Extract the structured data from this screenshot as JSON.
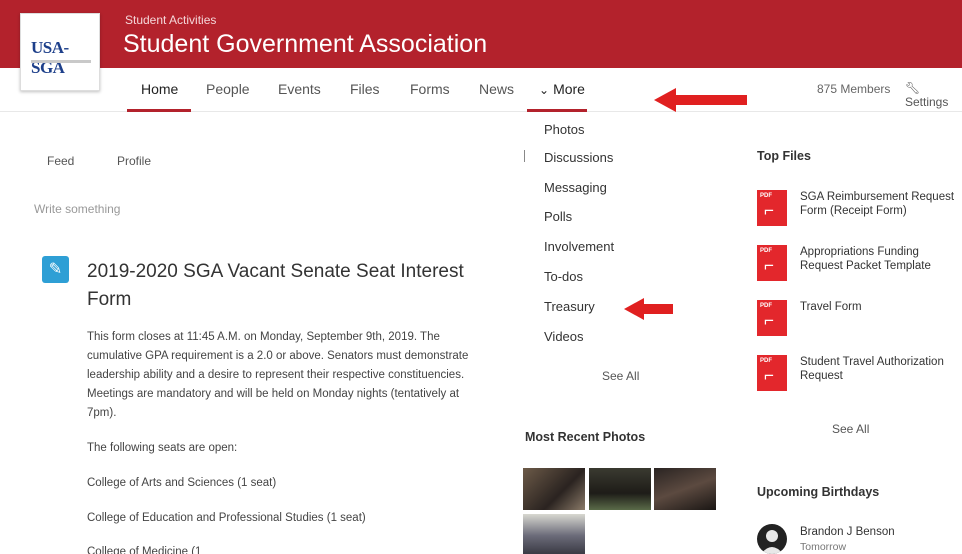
{
  "header": {
    "logo_text": "USA-SGA",
    "category": "Student Activities",
    "title": "Student Government Association"
  },
  "nav": {
    "items": [
      "Home",
      "People",
      "Events",
      "Files",
      "Forms",
      "News"
    ],
    "more_label": "More",
    "members": "875 Members",
    "settings": "Settings"
  },
  "feed": {
    "tabs": [
      "Feed",
      "Profile"
    ],
    "composer_placeholder": "Write something",
    "post": {
      "title": "2019-2020 SGA Vacant Senate Seat Interest Form",
      "body": "This form closes at 11:45 A.M. on Monday, September 9th, 2019. The cumulative GPA requirement is a 2.0 or above. Senators must demonstrate leadership ability and a desire to represent their respective constituencies. Meetings are mandatory and will be held on Monday nights (tentatively at 7pm).",
      "intro": "The following seats are open:",
      "seats": [
        "College of Arts and Sciences (1 seat)",
        "College of Education and Professional Studies (1 seat)",
        "College of Medicine (1"
      ]
    }
  },
  "more_menu": {
    "items": [
      "Photos",
      "Discussions",
      "Messaging",
      "Polls",
      "Involvement",
      "To-dos",
      "Treasury",
      "Videos"
    ],
    "see_all": "See All"
  },
  "photos": {
    "heading": "Most Recent Photos"
  },
  "top_files": {
    "heading": "Top Files",
    "files": [
      {
        "name": "SGA Reimbursement Request Form (Receipt Form)",
        "type": "PDF"
      },
      {
        "name": "Appropriations Funding Request Packet Template",
        "type": "PDF"
      },
      {
        "name": "Travel Form",
        "type": "PDF"
      },
      {
        "name": "Student Travel Authorization Request",
        "type": "PDF"
      }
    ],
    "see_all": "See All"
  },
  "birthdays": {
    "heading": "Upcoming Birthdays",
    "name": "Brandon J Benson",
    "when": "Tomorrow"
  },
  "colors": {
    "brand": "#b3222c",
    "annotation_arrow": "#e02020",
    "post_icon": "#2e9fd5",
    "pdf": "#e3272c"
  }
}
